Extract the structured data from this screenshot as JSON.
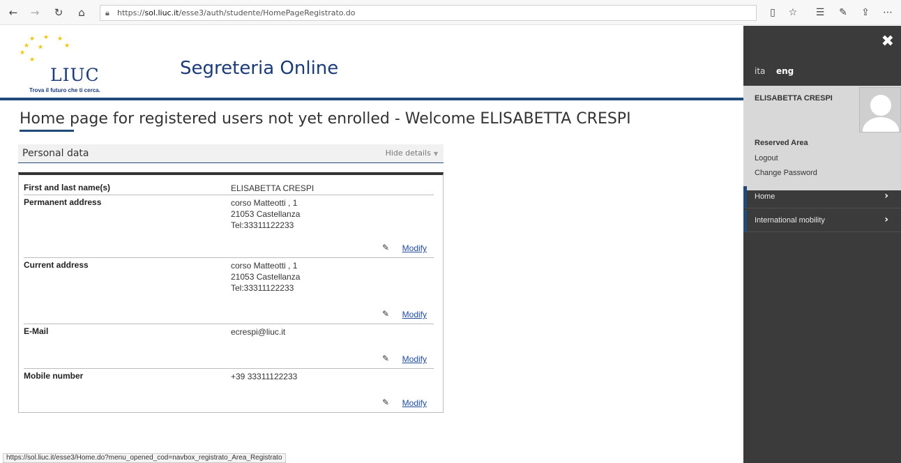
{
  "browser": {
    "url_prefix": "https://",
    "url_domain": "sol.liuc.it",
    "url_path": "/esse3/auth/studente/HomePageRegistrato.do",
    "status_url": "https://sol.liuc.it/esse3/Home.do?menu_opened_cod=navbox_registrato_Area_Registrato"
  },
  "header": {
    "logo_word": "LIUC",
    "logo_tagline": "Trova il futuro che ti cerca.",
    "site_title": "Segreteria Online"
  },
  "main": {
    "page_title": "Home page for registered users not yet enrolled - Welcome  ELISABETTA CRESPI",
    "section_title": "Personal data",
    "hide_details": "Hide details",
    "modify_label": "Modify",
    "rows": [
      {
        "label": "First and last name(s)",
        "lines": [
          "ELISABETTA CRESPI"
        ]
      },
      {
        "label": "Permanent address",
        "lines": [
          "corso Matteotti , 1",
          "21053 Castellanza",
          "Tel:33311122233"
        ]
      },
      {
        "label": "Current address",
        "lines": [
          "corso Matteotti , 1",
          "21053 Castellanza",
          "Tel:33311122233"
        ]
      },
      {
        "label": "E-Mail",
        "lines": [
          "ecrespi@liuc.it"
        ]
      },
      {
        "label": "Mobile number",
        "lines": [
          "+39 33311122233"
        ]
      }
    ]
  },
  "side_panel": {
    "lang_ita": "ita",
    "lang_eng": "eng",
    "user_name": "ELISABETTA CRESPI",
    "reserved_area": "Reserved Area",
    "logout": "Logout",
    "change_password": "Change Password",
    "menu": [
      {
        "label": "Home"
      },
      {
        "label": "International mobility"
      }
    ]
  },
  "colors": {
    "brand_blue": "#1f4a7a",
    "panel_bg": "#3b3b3b",
    "star_gold": "#f2c300"
  }
}
